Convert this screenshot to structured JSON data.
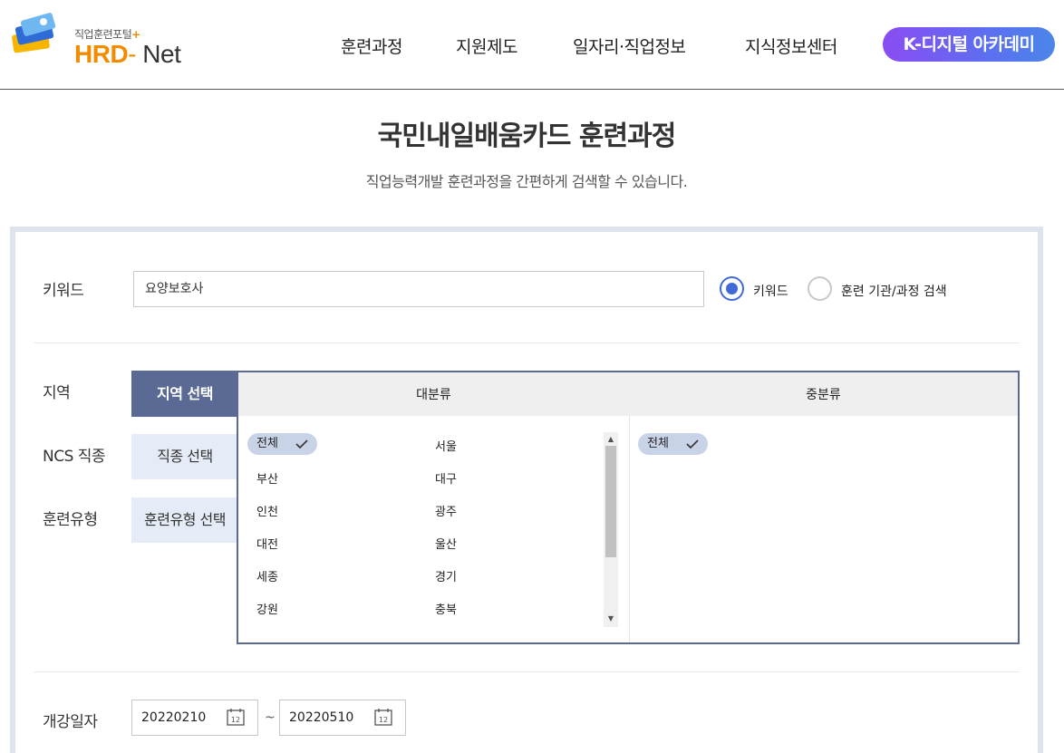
{
  "header": {
    "logo_sub": "직업훈련포털",
    "logo_plus": "+",
    "logo_hrd": "HRD",
    "logo_dash": "-",
    "logo_net": "Net",
    "nav": [
      "훈련과정",
      "지원제도",
      "일자리·직업정보",
      "지식정보센터"
    ],
    "cta": "K-디지털 아카데미",
    "cta_colors": [
      "#8a4cf2",
      "#4a86e8"
    ]
  },
  "page": {
    "title": "국민내일배움카드 훈련과정",
    "subtitle": "직업능력개발 훈련과정을 간편하게 검색할 수 있습니다."
  },
  "search": {
    "keyword_label": "키워드",
    "keyword_value": "요양보호사",
    "radio_options": [
      {
        "label": "키워드",
        "selected": true
      },
      {
        "label": "훈련 기관/과정 검색",
        "selected": false
      }
    ],
    "region_label": "지역",
    "ncs_label": "NCS 직종",
    "type_label": "훈련유형",
    "tabs": [
      "지역 선택",
      "직종 선택",
      "훈련유형 선택"
    ],
    "major_header": "대분류",
    "minor_header": "중분류",
    "major_selected": "전체",
    "major_items": [
      "서울",
      "부산",
      "대구",
      "인천",
      "광주",
      "대전",
      "울산",
      "세종",
      "경기",
      "강원",
      "충북"
    ],
    "minor_selected": "전체",
    "date_label": "개강일자",
    "date_from": "20220210",
    "date_to": "20220510",
    "date_sep": "~",
    "calendar_day": "12",
    "accent_color": "#3f6ad8",
    "tab_active_color": "#5b6a94"
  }
}
